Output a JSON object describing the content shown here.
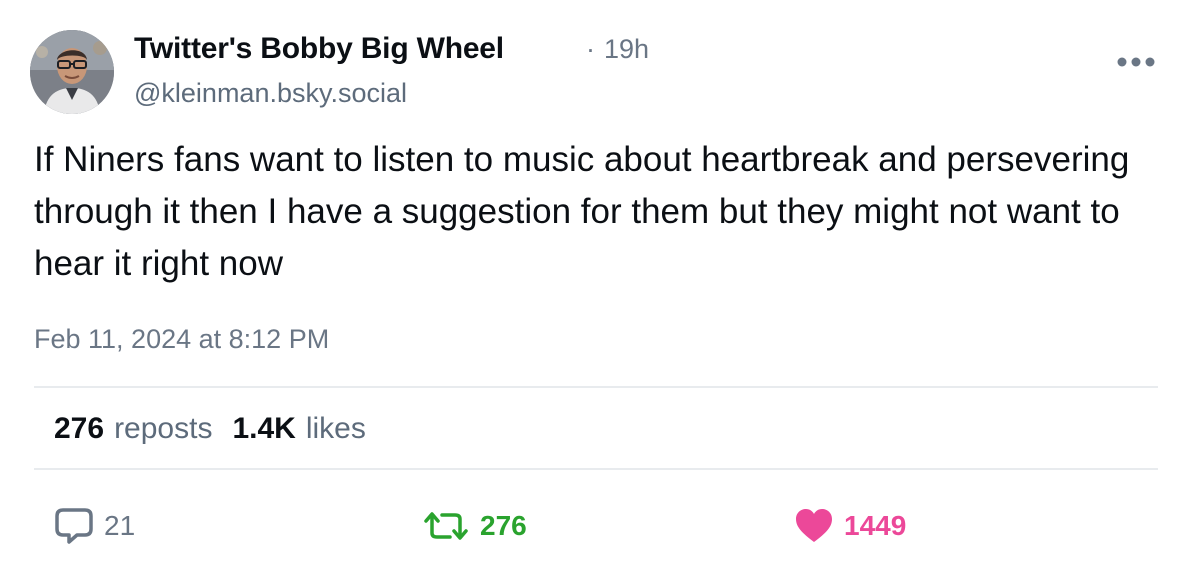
{
  "post": {
    "author": {
      "display_name": "Twitter's Bobby Big Wheel",
      "handle": "@kleinman.bsky.social",
      "avatar_icon": "profile-photo"
    },
    "time_separator": "·",
    "relative_time": "19h",
    "text": "If Niners fans want to listen to music about heartbreak and persevering through it then I have a suggestion for them but they might not want to hear it right now",
    "timestamp": "Feb 11, 2024 at 8:12 PM",
    "stats": {
      "reposts_count": "276",
      "reposts_label": "reposts",
      "likes_count": "1.4K",
      "likes_label": "likes"
    },
    "actions": {
      "reply": {
        "count": "21",
        "icon": "reply-bubble-icon"
      },
      "repost": {
        "count": "276",
        "icon": "repost-arrows-icon",
        "color": "#2aa32e"
      },
      "like": {
        "count": "1449",
        "icon": "heart-icon",
        "color": "#ec4899"
      }
    },
    "more_icon": "ellipsis-icon"
  }
}
